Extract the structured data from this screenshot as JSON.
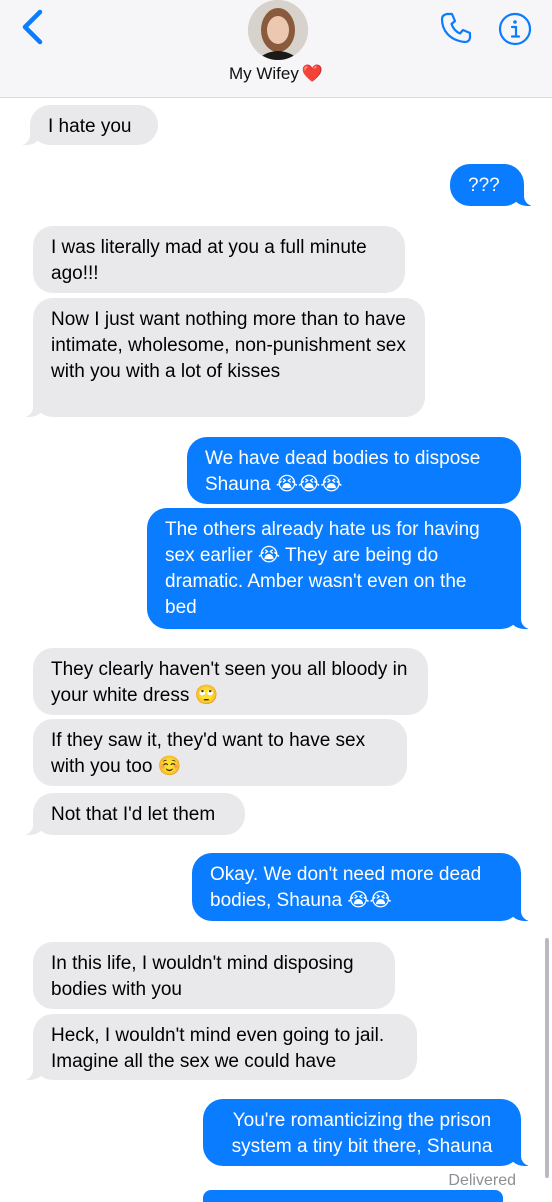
{
  "header": {
    "contact_name": "My Wifey",
    "heart_emoji": "❤️",
    "icons": [
      "chevron-left-icon",
      "avatar",
      "phone-icon",
      "info-icon"
    ],
    "accent_color": "#0a7cff"
  },
  "messages": [
    {
      "side": "incoming",
      "text": "I hate you"
    },
    {
      "side": "outgoing",
      "text": "???"
    },
    {
      "side": "incoming",
      "text": "I was literally mad at you a full minute ago!!!"
    },
    {
      "side": "incoming",
      "text": "Now I just want nothing more than to have intimate, wholesome, non-punishment sex with you with a lot of kisses"
    },
    {
      "side": "outgoing",
      "text": "We have dead bodies to dispose Shauna 😭😭😭"
    },
    {
      "side": "outgoing",
      "text": "The others already hate us for having sex earlier 😭 They are being do dramatic. Amber wasn't even on the bed"
    },
    {
      "side": "incoming",
      "text": "They clearly haven't seen you all bloody in your white dress 🙄"
    },
    {
      "side": "incoming",
      "text": "If they saw it, they'd want to have sex with you too ☺️"
    },
    {
      "side": "incoming",
      "text": "Not that I'd let them"
    },
    {
      "side": "outgoing",
      "text": "Okay. We don't need more dead bodies, Shauna 😭😭"
    },
    {
      "side": "incoming",
      "text": "In this life, I wouldn't mind disposing bodies with you"
    },
    {
      "side": "incoming",
      "text": "Heck, I wouldn't mind even going to jail. Imagine all the sex we could have"
    },
    {
      "side": "outgoing",
      "text": "You're romanticizing the prison system a tiny bit there, Shauna"
    }
  ],
  "status": {
    "delivered": "Delivered"
  },
  "colors": {
    "incoming_bubble": "#e9e9eb",
    "outgoing_bubble": "#0a7cff",
    "header_bg": "#f6f6f8"
  }
}
